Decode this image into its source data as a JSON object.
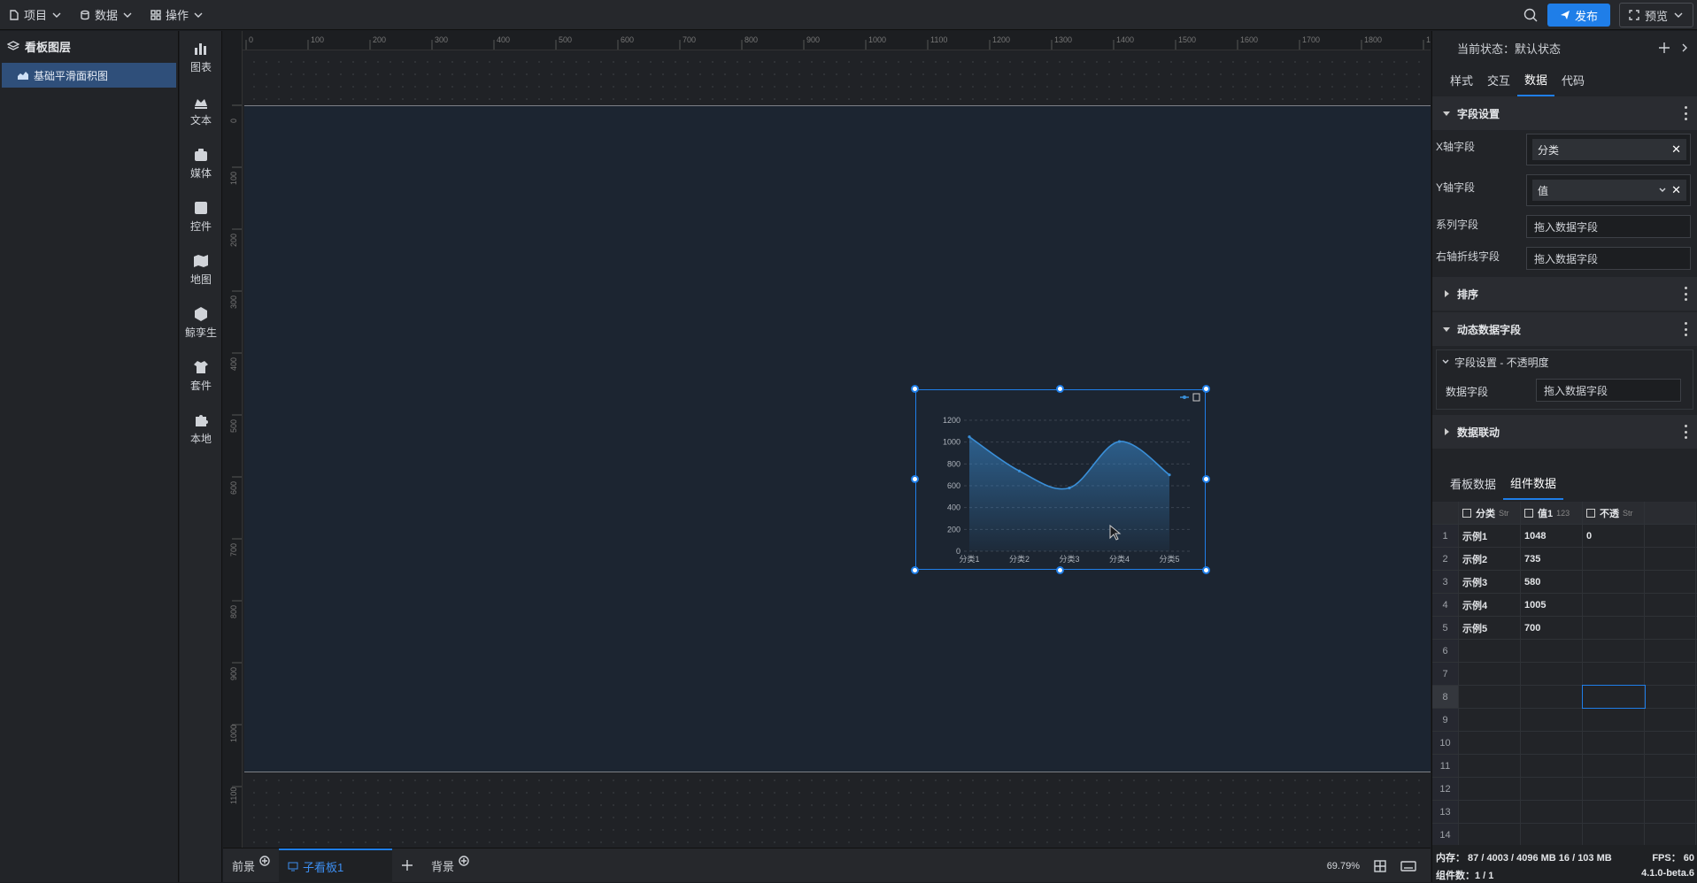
{
  "topbar": {
    "menus": [
      {
        "label": "项目",
        "icon": "file-icon"
      },
      {
        "label": "数据",
        "icon": "database-icon"
      },
      {
        "label": "操作",
        "icon": "grid-icon"
      }
    ],
    "publish_label": "发布",
    "preview_label": "预览"
  },
  "layers": {
    "title": "看板图层",
    "items": [
      {
        "label": "基础平滑面积图"
      }
    ]
  },
  "tools": [
    {
      "label": "图表",
      "icon": "chart-icon"
    },
    {
      "label": "文本",
      "icon": "text-icon"
    },
    {
      "label": "媒体",
      "icon": "media-icon"
    },
    {
      "label": "控件",
      "icon": "control-icon"
    },
    {
      "label": "地图",
      "icon": "map-icon"
    },
    {
      "label": "鲸孪生",
      "icon": "cube-icon"
    },
    {
      "label": "套件",
      "icon": "shirt-icon"
    },
    {
      "label": "本地",
      "icon": "puzzle-icon"
    }
  ],
  "ruler": {
    "h_ticks": [
      "0",
      "100",
      "200",
      "300",
      "400",
      "500",
      "600",
      "700",
      "800",
      "900",
      "1000",
      "1100",
      "1200",
      "1300",
      "1400",
      "1500",
      "1600",
      "1700",
      "1800",
      "1900"
    ],
    "v_ticks": [
      "0",
      "100",
      "200",
      "300",
      "400",
      "500",
      "600",
      "700",
      "800",
      "900",
      "1000",
      "1100"
    ]
  },
  "chart_data": {
    "type": "area",
    "categories": [
      "分类1",
      "分类2",
      "分类3",
      "分类4",
      "分类5"
    ],
    "values": [
      1048,
      735,
      580,
      1005,
      700
    ],
    "y_ticks": [
      "0",
      "200",
      "400",
      "600",
      "800",
      "1000",
      "1200"
    ],
    "ylim": [
      0,
      1200
    ],
    "smooth": true,
    "grid": true,
    "color": "#3a8fd8"
  },
  "bottombar": {
    "front_label": "前景",
    "sub_label": "子看板1",
    "back_label": "背景",
    "zoom": "69.79%"
  },
  "right": {
    "state_label": "当前状态：默认状态",
    "tabs": [
      "样式",
      "交互",
      "数据",
      "代码"
    ],
    "field_section": "字段设置",
    "x_label": "X轴字段",
    "x_value": "分类",
    "y_label": "Y轴字段",
    "y_value": "值",
    "series_label": "系列字段",
    "series_placeholder": "拖入数据字段",
    "right_line_label": "右轴折线字段",
    "right_line_placeholder": "拖入数据字段",
    "sort_section": "排序",
    "dynamic_section": "动态数据字段",
    "sub_section": "字段设置 - 不透明度",
    "data_field_label": "数据字段",
    "data_field_placeholder": "拖入数据字段",
    "link_section": "数据联动",
    "data_tabs": [
      "看板数据",
      "组件数据"
    ],
    "table": {
      "headers": [
        {
          "label": "分类",
          "type": "Str"
        },
        {
          "label": "值1",
          "type": "123"
        },
        {
          "label": "不透",
          "type": "Str"
        }
      ],
      "rows": [
        [
          "1",
          "示例1",
          "1048",
          "0"
        ],
        [
          "2",
          "示例2",
          "735",
          ""
        ],
        [
          "3",
          "示例3",
          "580",
          ""
        ],
        [
          "4",
          "示例4",
          "1005",
          ""
        ],
        [
          "5",
          "示例5",
          "700",
          ""
        ],
        [
          "6",
          "",
          "",
          ""
        ],
        [
          "7",
          "",
          "",
          ""
        ],
        [
          "8",
          "",
          "",
          ""
        ],
        [
          "9",
          "",
          "",
          ""
        ],
        [
          "10",
          "",
          "",
          ""
        ],
        [
          "11",
          "",
          "",
          ""
        ],
        [
          "12",
          "",
          "",
          ""
        ],
        [
          "13",
          "",
          "",
          ""
        ],
        [
          "14",
          "",
          "",
          ""
        ]
      ]
    },
    "status": {
      "memory": "内存： 87 / 4003 / 4096 MB  16 / 103 MB",
      "fps": "FPS： 60",
      "components": "组件数：1 / 1",
      "version": "4.1.0-beta.6"
    }
  }
}
